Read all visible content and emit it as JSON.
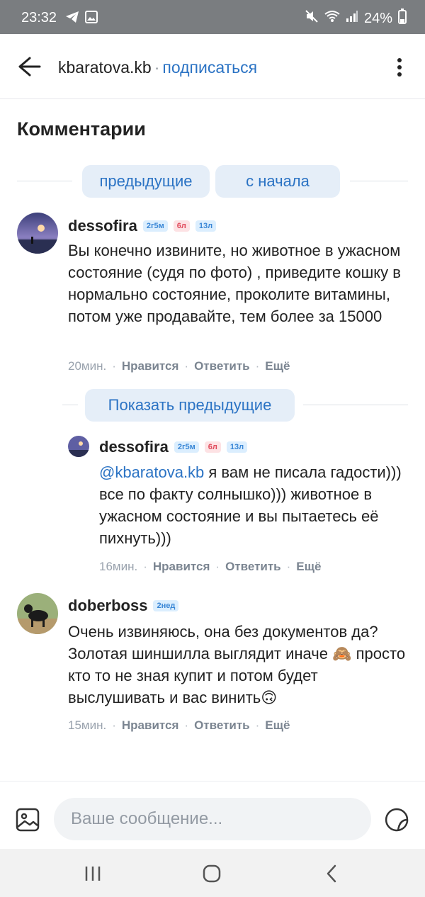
{
  "status_bar": {
    "time": "23:32",
    "battery": "24%",
    "icons": [
      "telegram-icon",
      "gallery-icon",
      "mute-icon",
      "wifi-icon",
      "signal-icon",
      "battery-icon"
    ]
  },
  "header": {
    "title": "kbaratova.kb",
    "separator": "·",
    "subscribe_label": "подписаться"
  },
  "section_title": "Комментарии",
  "nav": {
    "previous_label": "предыдущие",
    "from_start_label": "с начала"
  },
  "comments": [
    {
      "author": "dessofira",
      "badges": [
        "2г5м",
        "6л",
        "13л"
      ],
      "text": "Вы конечно извините, но животное в ужасном состояние  (судя по фото) , приведите кошку в нормально состояние, проколите витамины, потом уже продавайте, тем более за 15000",
      "time": "20мин.",
      "like_label": "Нравится",
      "reply_label": "Ответить",
      "more_label": "Ещё"
    }
  ],
  "show_previous_label": "Показать предыдущие",
  "reply": {
    "author": "dessofira",
    "badges": [
      "2г5м",
      "6л",
      "13л"
    ],
    "mention": "@kbaratova.kb",
    "text": " я вам не писала гадости))) все по факту солнышко))) животное в ужасном состояние и вы пытаетесь её пихнуть)))",
    "time": "16мин.",
    "like_label": "Нравится",
    "reply_label": "Ответить",
    "more_label": "Ещё"
  },
  "comment2": {
    "author": "doberboss",
    "badges": [
      "2нед"
    ],
    "text": "Очень извиняюсь, она без документов да? Золотая шиншилла выглядит иначе 🙈 просто кто то не зная купит и потом будет выслушивать и вас винить🙃",
    "time": "15мин.",
    "like_label": "Нравится",
    "reply_label": "Ответить",
    "more_label": "Ещё"
  },
  "composer": {
    "placeholder": "Ваше сообщение..."
  },
  "colors": {
    "accent": "#2b73c4",
    "pill_bg": "#e5eef8",
    "status_bar": "#7a7d80"
  }
}
